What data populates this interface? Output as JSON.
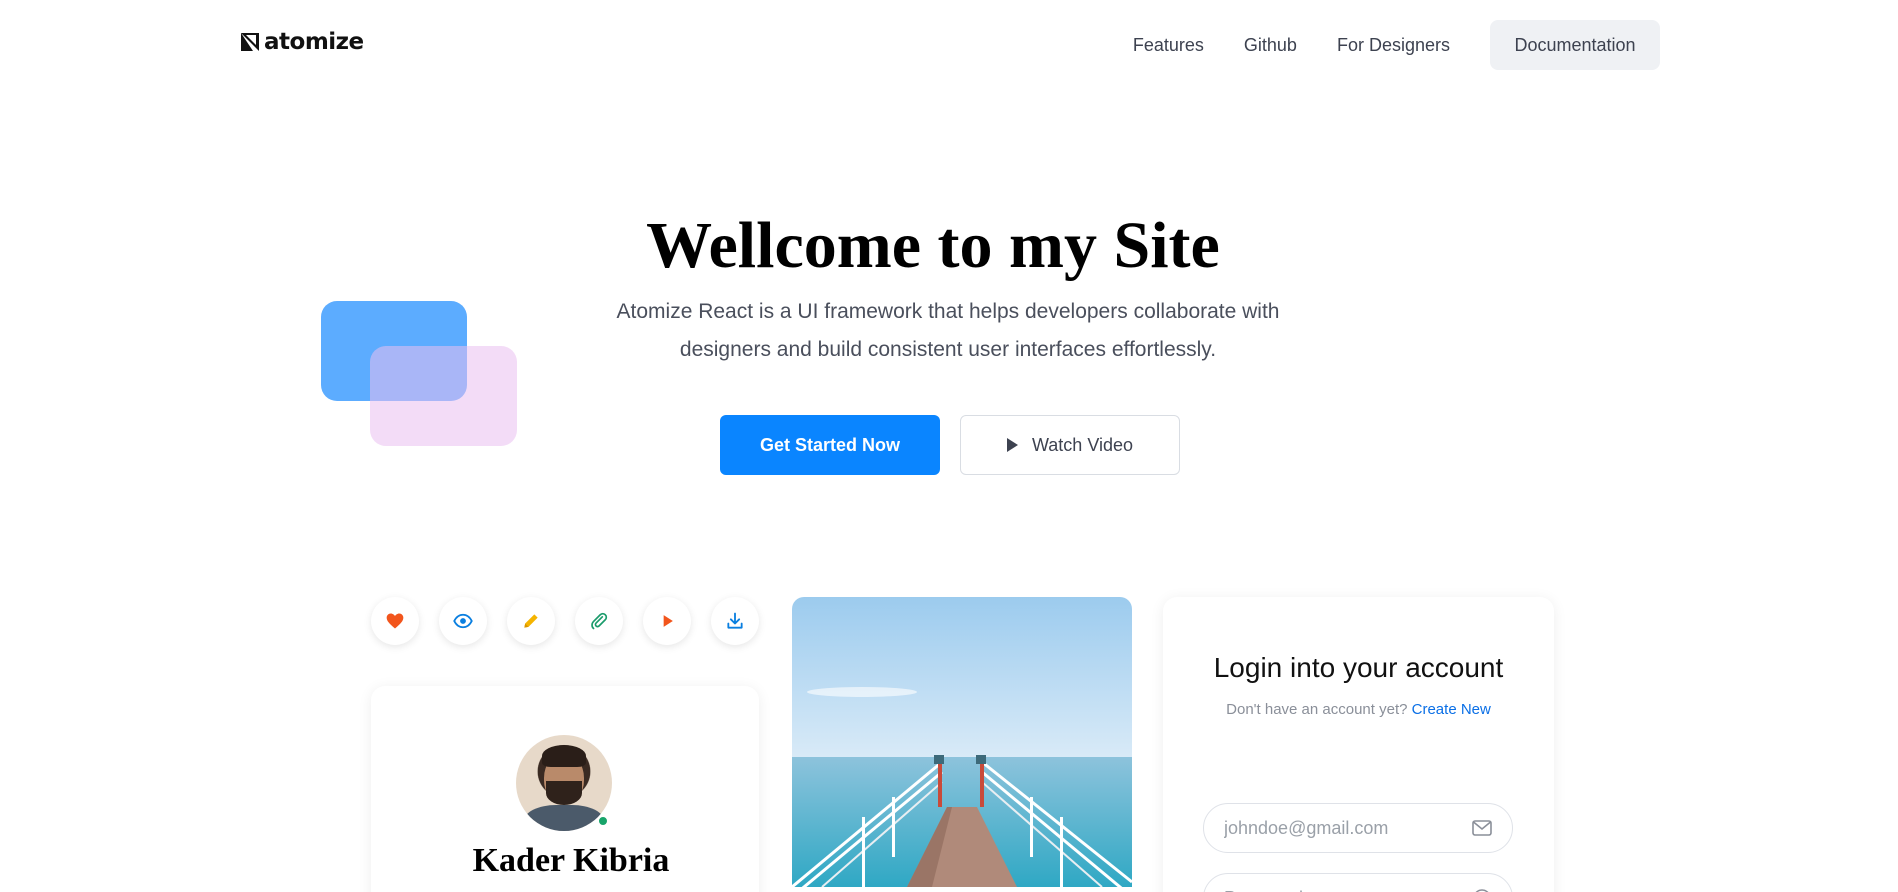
{
  "header": {
    "logo_text": "atomize",
    "nav": [
      {
        "label": "Features"
      },
      {
        "label": "Github"
      },
      {
        "label": "For Designers"
      }
    ],
    "doc_button": "Documentation"
  },
  "hero": {
    "title": "Wellcome to my Site",
    "subtitle": "Atomize React is a UI framework that helps developers collaborate with designers and build consistent user interfaces effortlessly.",
    "primary_button": "Get Started Now",
    "secondary_button": "Watch Video"
  },
  "icon_buttons": [
    {
      "icon": "heart-icon",
      "color": "#f2551c"
    },
    {
      "icon": "eye-icon",
      "color": "#0a7fe0"
    },
    {
      "icon": "pencil-icon",
      "color": "#f5b400"
    },
    {
      "icon": "paperclip-icon",
      "color": "#1a9b6b"
    },
    {
      "icon": "play-icon",
      "color": "#f2551c"
    },
    {
      "icon": "download-icon",
      "color": "#0a7fe0"
    }
  ],
  "profile": {
    "name": "Kader Kibria",
    "status_color": "#18a46a"
  },
  "login": {
    "title": "Login into your account",
    "prompt": "Don't have an account yet?",
    "link": "Create New",
    "email_placeholder": "johndoe@gmail.com",
    "password_placeholder": "Password"
  },
  "colors": {
    "primary": "#0a85ff",
    "shape_blue": "#5cacff",
    "shape_pink": "#eac0f0"
  }
}
